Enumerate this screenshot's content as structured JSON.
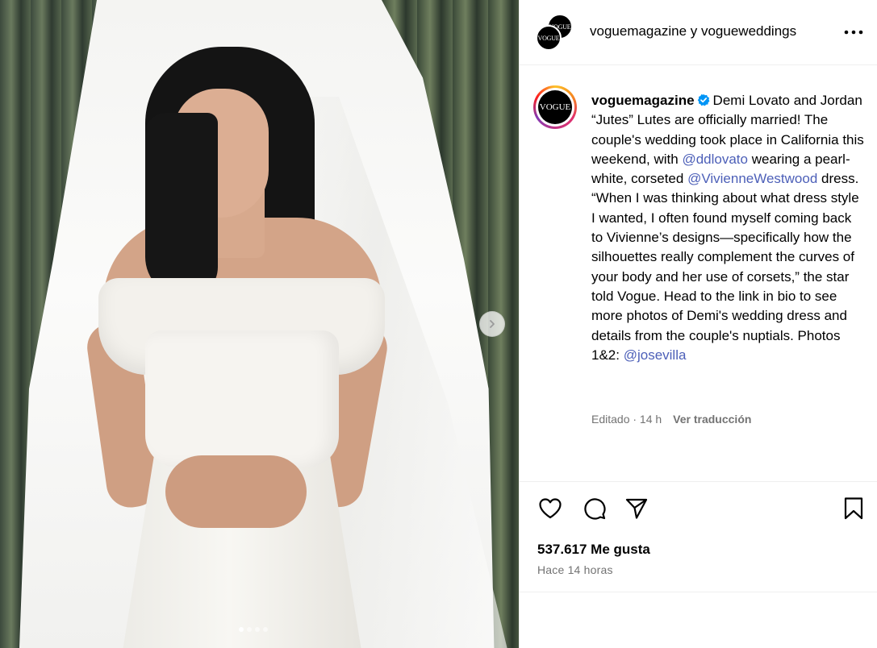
{
  "post": {
    "header": {
      "title": "voguemagazine y vogueweddings",
      "avatar_back_text": "VOGUE",
      "avatar_front_text": "VOGUE",
      "more_icon": "more-horizontal-icon"
    },
    "caption": {
      "avatar_text": "VOGUE",
      "username": "voguemagazine",
      "verified_icon": "verified-badge-icon",
      "verified_color": "#0095f6",
      "text_1": "Demi Lovato and Jordan “Jutes” Lutes are officially married! The couple's wedding took place in California this weekend, with ",
      "mention_1": "@ddlovato",
      "text_2": " wearing a pearl-white, corseted ",
      "mention_2": "@VivienneWestwood",
      "text_3": " dress. “When I was thinking about what dress style I wanted, I often found myself coming back to Vivienne’s designs—specifically how the silhouettes really complement the curves of your body and her use of corsets,” the star told Vogue. Head to the link in bio to see more photos of Demi's wedding dress and details from the couple's nuptials. Photos 1&2: ",
      "mention_3": "@josevilla",
      "link_color": "#4c5fb8"
    },
    "meta": {
      "edited": "Editado · 14 h",
      "translate": "Ver traducción"
    },
    "actions": {
      "like_icon": "heart-icon",
      "comment_icon": "comment-icon",
      "share_icon": "send-icon",
      "save_icon": "bookmark-icon"
    },
    "likes": "537.617 Me gusta",
    "time_ago": "Hace 14 horas"
  },
  "carousel": {
    "next_icon": "chevron-right-icon",
    "slide_count": 4,
    "active_slide": 1
  }
}
